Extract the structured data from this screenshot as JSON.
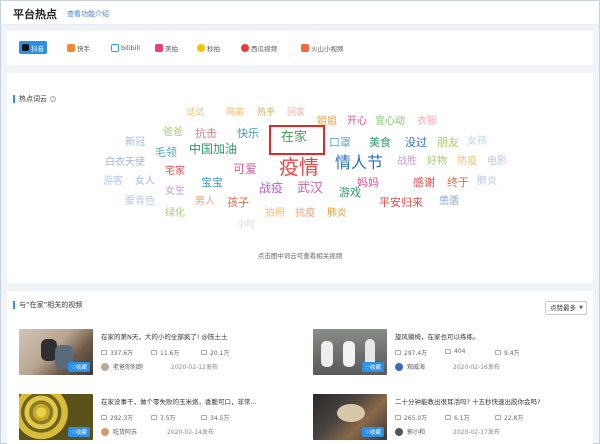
{
  "header": {
    "title": "平台热点",
    "intro_link": "查看功能介绍"
  },
  "platform_tabs": [
    {
      "label": "抖音",
      "icon": "douyin-icon",
      "active": true
    },
    {
      "label": "快手",
      "icon": "kuaishou-icon",
      "active": false
    },
    {
      "label": "bilibili",
      "icon": "bilibili-icon",
      "active": false
    },
    {
      "label": "美拍",
      "icon": "meipai-icon",
      "active": false
    },
    {
      "label": "秒拍",
      "icon": "miaopai-icon",
      "active": false
    },
    {
      "label": "西瓜视频",
      "icon": "xigua-icon",
      "active": false
    },
    {
      "label": "火山小视频",
      "icon": "huoshan-icon",
      "active": false
    }
  ],
  "word_cloud": {
    "section_title": "热点词云",
    "hint": "点击图中词云可查看相关视频",
    "selected_word": "在家",
    "words": [
      "试试",
      "隔离",
      "热乎",
      "回家",
      "姐姐",
      "开心",
      "宜心动",
      "衣服",
      "爸爸",
      "抗击",
      "快乐",
      "在家",
      "口罩",
      "美食",
      "没过",
      "朋友",
      "女孩",
      "新冠",
      "毛领",
      "中国加油",
      "情人节",
      "战胜",
      "好物",
      "防疫",
      "电影",
      "白衣天使",
      "宅家",
      "可爱",
      "疫情",
      "妈妈",
      "感谢",
      "终于",
      "肺炎",
      "游客",
      "女人",
      "女生",
      "宝宝",
      "战疫",
      "武汉",
      "游戏",
      "感恩",
      "要肯色",
      "男人",
      "孩子",
      "平安归来",
      "生活",
      "绿化",
      "拍照",
      "抗疫",
      "肺炎",
      "小时"
    ]
  },
  "videos_section": {
    "title": "与“在家”相关的视频",
    "sort_label": "点赞最多",
    "collect_label": "收藏",
    "videos": [
      {
        "title": "在家的第N天，大的小的全部疯了! @陈土土",
        "plays": "337.6万",
        "comments": "11.6万",
        "likes": "20.1万",
        "author": "老爸你别跑",
        "date": "2020-02-12发布"
      },
      {
        "title": "旋风躺椅，在家也可以练练。",
        "plays": "297.4万",
        "comments": "404",
        "likes": "9.4万",
        "author": "观威海",
        "date": "2020-02-16发布"
      },
      {
        "title": "在家没事干，做个零失败的玉米烙，香脆可口，非常...",
        "plays": "292.3万",
        "comments": "7.5万",
        "likes": "34.5万",
        "author": "吃货阿苏",
        "date": "2020-02-14发布"
      },
      {
        "title": "二十分钟能教出很耳活吗? 十五秒快速出胶你会吗?",
        "plays": "265.0万",
        "comments": "6.1万",
        "likes": "22.8万",
        "author": "郭小和",
        "date": "2020-02-17发布"
      }
    ]
  },
  "colors": {
    "accent": "#2c8fe8",
    "highlight_border": "#e02a2a"
  }
}
